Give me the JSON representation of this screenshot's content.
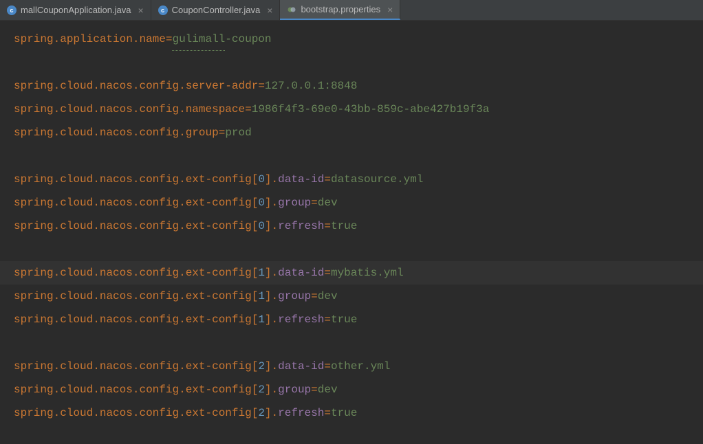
{
  "tabs": [
    {
      "label": "mallCouponApplication.java",
      "icon": "c",
      "iconType": "java",
      "active": false
    },
    {
      "label": "CouponController.java",
      "icon": "c",
      "iconType": "java",
      "active": false
    },
    {
      "label": "bootstrap.properties",
      "icon": "props",
      "iconType": "props",
      "active": true
    }
  ],
  "lines": [
    {
      "type": "kv",
      "keyParts": [
        "spring",
        "application",
        "name"
      ],
      "value": "gulimall-coupon",
      "valueParts": [
        {
          "text": "gulimall",
          "class": "value squiggly"
        },
        {
          "text": "-coupon",
          "class": "value"
        }
      ],
      "highlighted": false
    },
    {
      "type": "empty"
    },
    {
      "type": "kv",
      "keyParts": [
        "spring",
        "cloud",
        "nacos",
        "config",
        "server-addr"
      ],
      "value": "127.0.0.1:8848",
      "highlighted": false
    },
    {
      "type": "kv",
      "keyParts": [
        "spring",
        "cloud",
        "nacos",
        "config",
        "namespace"
      ],
      "value": "1986f4f3-69e0-43bb-859c-abe427b19f3a",
      "highlighted": false
    },
    {
      "type": "kv",
      "keyParts": [
        "spring",
        "cloud",
        "nacos",
        "config",
        "group"
      ],
      "value": "prod",
      "highlighted": false
    },
    {
      "type": "empty"
    },
    {
      "type": "kv-indexed",
      "keyParts": [
        "spring",
        "cloud",
        "nacos",
        "config",
        "ext-config"
      ],
      "index": "0",
      "suffix": "data-id",
      "value": "datasource.yml",
      "highlighted": false
    },
    {
      "type": "kv-indexed",
      "keyParts": [
        "spring",
        "cloud",
        "nacos",
        "config",
        "ext-config"
      ],
      "index": "0",
      "suffix": "group",
      "value": "dev",
      "highlighted": false
    },
    {
      "type": "kv-indexed",
      "keyParts": [
        "spring",
        "cloud",
        "nacos",
        "config",
        "ext-config"
      ],
      "index": "0",
      "suffix": "refresh",
      "value": "true",
      "highlighted": false
    },
    {
      "type": "empty"
    },
    {
      "type": "kv-indexed",
      "keyParts": [
        "spring",
        "cloud",
        "nacos",
        "config",
        "ext-config"
      ],
      "index": "1",
      "suffix": "data-id",
      "value": "mybatis.yml",
      "highlighted": true
    },
    {
      "type": "kv-indexed",
      "keyParts": [
        "spring",
        "cloud",
        "nacos",
        "config",
        "ext-config"
      ],
      "index": "1",
      "suffix": "group",
      "value": "dev",
      "highlighted": false
    },
    {
      "type": "kv-indexed",
      "keyParts": [
        "spring",
        "cloud",
        "nacos",
        "config",
        "ext-config"
      ],
      "index": "1",
      "suffix": "refresh",
      "value": "true",
      "highlighted": false
    },
    {
      "type": "empty"
    },
    {
      "type": "kv-indexed",
      "keyParts": [
        "spring",
        "cloud",
        "nacos",
        "config",
        "ext-config"
      ],
      "index": "2",
      "suffix": "data-id",
      "value": "other.yml",
      "highlighted": false
    },
    {
      "type": "kv-indexed",
      "keyParts": [
        "spring",
        "cloud",
        "nacos",
        "config",
        "ext-config"
      ],
      "index": "2",
      "suffix": "group",
      "value": "dev",
      "highlighted": false
    },
    {
      "type": "kv-indexed",
      "keyParts": [
        "spring",
        "cloud",
        "nacos",
        "config",
        "ext-config"
      ],
      "index": "2",
      "suffix": "refresh",
      "value": "true",
      "highlighted": false
    }
  ]
}
